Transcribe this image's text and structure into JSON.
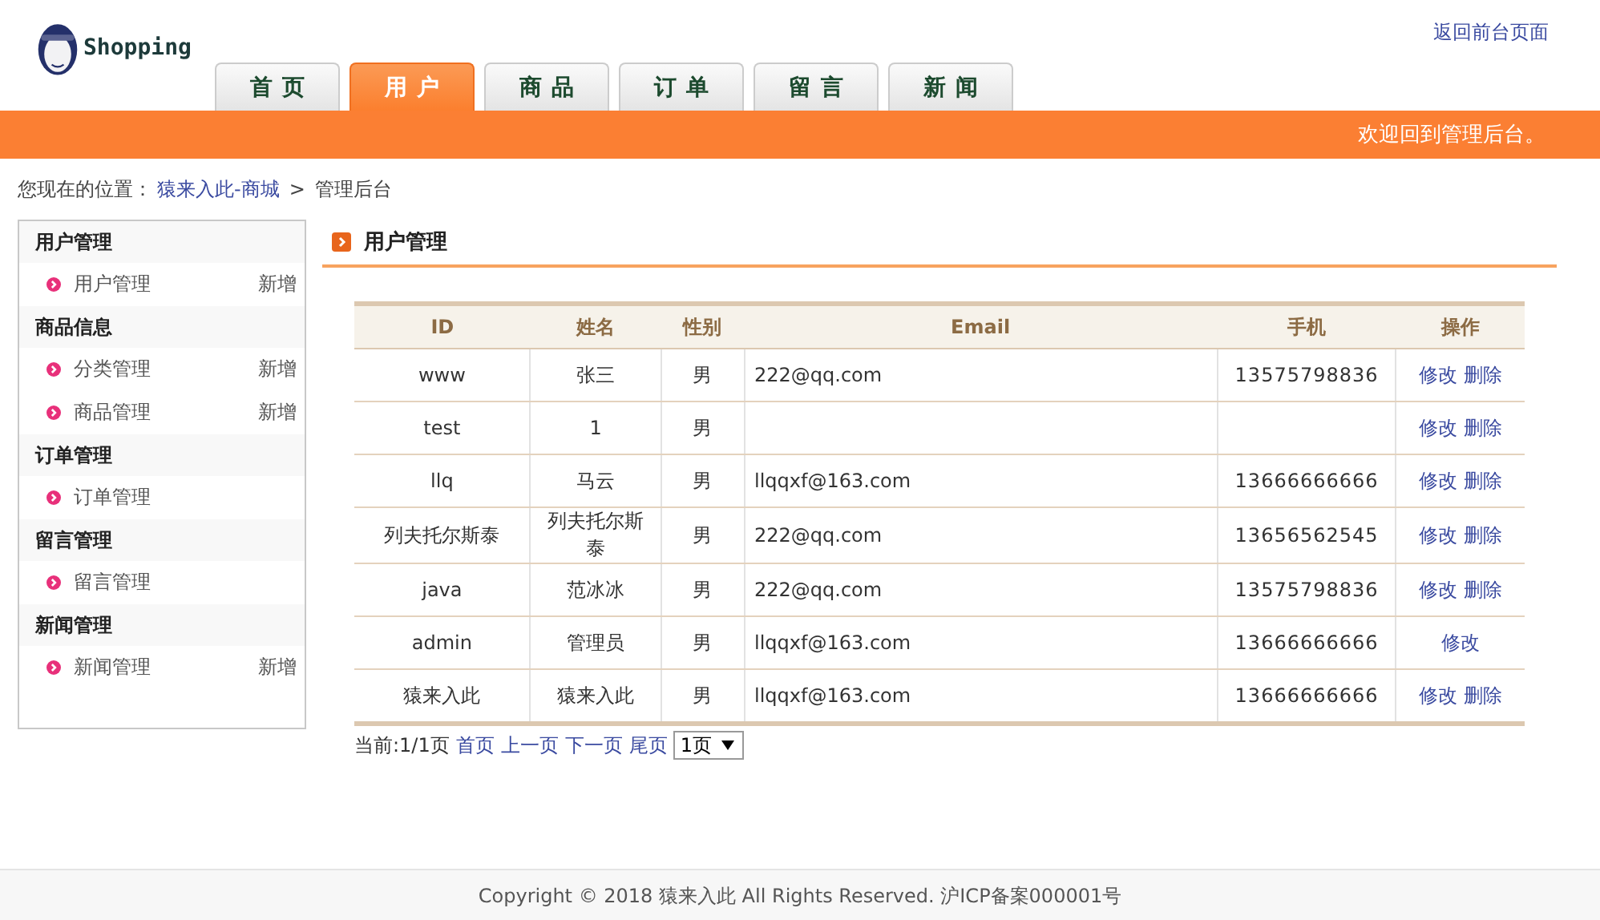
{
  "logo": {
    "text": "Shopping"
  },
  "header_link": "返回前台页面",
  "tabs": [
    {
      "label": "首页",
      "selected": false
    },
    {
      "label": "用户",
      "selected": true
    },
    {
      "label": "商品",
      "selected": false
    },
    {
      "label": "订单",
      "selected": false
    },
    {
      "label": "留言",
      "selected": false
    },
    {
      "label": "新闻",
      "selected": false
    }
  ],
  "welcome": "欢迎回到管理后台。",
  "breadcrumb": {
    "prefix": "您现在的位置：",
    "link": "猿来入此-商城",
    "separator": ">",
    "current": "管理后台"
  },
  "sidebar": [
    {
      "title": "用户管理",
      "items": [
        {
          "label": "用户管理",
          "action": "新增"
        }
      ]
    },
    {
      "title": "商品信息",
      "items": [
        {
          "label": "分类管理",
          "action": "新增"
        },
        {
          "label": "商品管理",
          "action": "新增"
        }
      ]
    },
    {
      "title": "订单管理",
      "items": [
        {
          "label": "订单管理"
        }
      ]
    },
    {
      "title": "留言管理",
      "items": [
        {
          "label": "留言管理"
        }
      ]
    },
    {
      "title": "新闻管理",
      "items": [
        {
          "label": "新闻管理",
          "action": "新增"
        }
      ]
    }
  ],
  "section_title": "用户管理",
  "table": {
    "columns": [
      "ID",
      "姓名",
      "性别",
      "Email",
      "手机",
      "操作"
    ],
    "rows": [
      {
        "id": "www",
        "name": "张三",
        "gender": "男",
        "email": "222@qq.com",
        "phone": "13575798836",
        "actions": [
          "修改",
          "删除"
        ]
      },
      {
        "id": "test",
        "name": "1",
        "gender": "男",
        "actions": [
          "修改",
          "删除"
        ]
      },
      {
        "id": "llq",
        "name": "马云",
        "gender": "男",
        "email": "llqqxf@163.com",
        "phone": "13666666666",
        "actions": [
          "修改",
          "删除"
        ]
      },
      {
        "id": "列夫托尔斯泰",
        "name": "列夫托尔斯泰",
        "gender": "男",
        "email": "222@qq.com",
        "phone": "13656562545",
        "actions": [
          "修改",
          "删除"
        ]
      },
      {
        "id": "java",
        "name": "范冰冰",
        "gender": "男",
        "email": "222@qq.com",
        "phone": "13575798836",
        "actions": [
          "修改",
          "删除"
        ]
      },
      {
        "id": "admin",
        "name": "管理员",
        "gender": "男",
        "email": "llqqxf@163.com",
        "phone": "13666666666",
        "actions": [
          "修改"
        ]
      },
      {
        "id": "猿来入此",
        "name": "猿来入此",
        "gender": "男",
        "email": "llqqxf@163.com",
        "phone": "13666666666",
        "actions": [
          "修改",
          "删除"
        ]
      }
    ]
  },
  "pager": {
    "status": "当前:1/1页",
    "links": [
      "首页",
      "上一页",
      "下一页",
      "尾页"
    ],
    "select": "1页"
  },
  "footer": "Copyright © 2018 猿来入此 All Rights Reserved. 沪ICP备案000001号"
}
